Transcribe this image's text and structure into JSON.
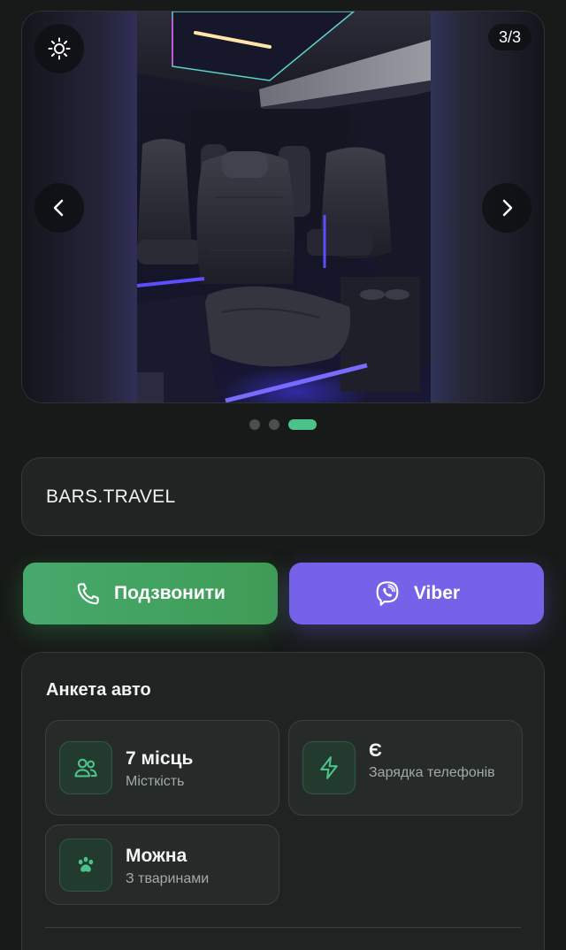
{
  "gallery": {
    "counter": "3/3",
    "current_index": 3,
    "total": 3,
    "controls": {
      "brightness_icon": "sun-icon",
      "prev_icon": "chevron-left-icon",
      "next_icon": "chevron-right-icon"
    }
  },
  "pagination": {
    "count": 3,
    "active_index": 3,
    "active_color": "#4cc28a"
  },
  "company": {
    "name": "BARS.TRAVEL"
  },
  "actions": {
    "call": {
      "label": "Подзвонити",
      "icon": "phone-icon",
      "color": "#46a96c"
    },
    "viber": {
      "label": "Viber",
      "icon": "viber-icon",
      "color": "#7562e8"
    }
  },
  "profile": {
    "title": "Анкета авто",
    "features": [
      {
        "value": "7 місць",
        "label": "Місткість",
        "icon": "users-icon"
      },
      {
        "value": "Є",
        "label": "Зарядка телефонів",
        "icon": "lightning-icon"
      },
      {
        "value": "Можна",
        "label": "З тваринами",
        "icon": "paw-icon"
      }
    ]
  }
}
